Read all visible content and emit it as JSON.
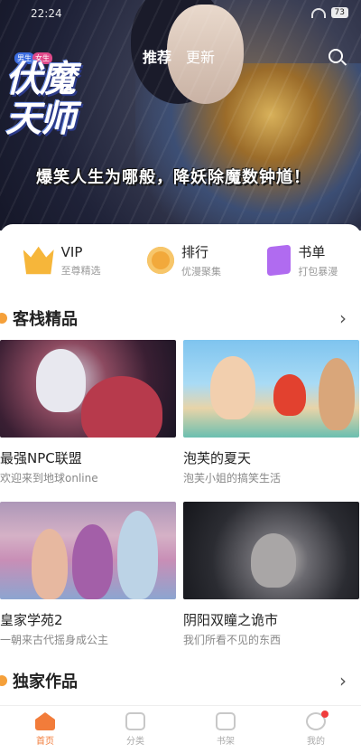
{
  "status_bar": {
    "time": "22:24",
    "battery": "73"
  },
  "hero": {
    "badges": [
      "男生",
      "女生"
    ],
    "title_art": "伏魔天师",
    "tabs": [
      {
        "label": "推荐",
        "active": true
      },
      {
        "label": "更新",
        "active": false
      }
    ],
    "slogan": "爆笑人生为哪般，降妖除魔数钟馗！"
  },
  "shortcuts": [
    {
      "icon": "crown-icon",
      "title": "VIP",
      "sub": "至尊精选"
    },
    {
      "icon": "medal-icon",
      "title": "排行",
      "sub": "优漫聚集"
    },
    {
      "icon": "book-icon",
      "title": "书单",
      "sub": "打包暴漫"
    }
  ],
  "sections": [
    {
      "title": "客栈精品",
      "arrow": "›"
    },
    {
      "title": "独家作品",
      "arrow": "›"
    }
  ],
  "cards": [
    {
      "title": "最强NPC联盟",
      "sub": "欢迎来到地球online"
    },
    {
      "title": "泡芙的夏天",
      "sub": "泡芙小姐的搞笑生活"
    },
    {
      "title": "皇家学苑2",
      "sub": "一朝来古代摇身成公主"
    },
    {
      "title": "阴阳双瞳之诡市",
      "sub": "我们所看不见的东西"
    }
  ],
  "tabbar": [
    {
      "label": "首页",
      "icon": "home-icon",
      "active": true
    },
    {
      "label": "分类",
      "icon": "category-icon",
      "active": false
    },
    {
      "label": "书架",
      "icon": "bookshelf-icon",
      "active": false
    },
    {
      "label": "我的",
      "icon": "profile-icon",
      "active": false,
      "badge": true
    }
  ],
  "colors": {
    "accent": "#f27c3a",
    "badge": "#f03c3c"
  }
}
